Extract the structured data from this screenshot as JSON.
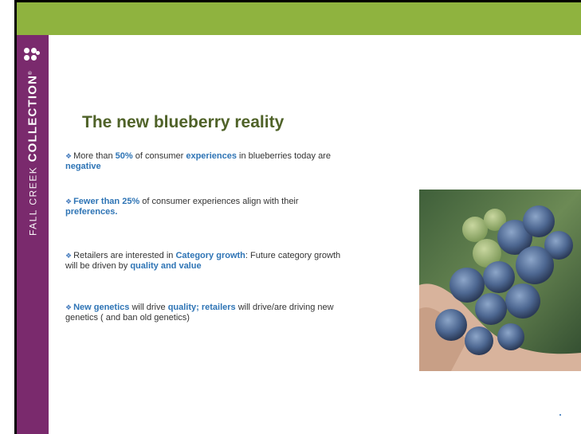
{
  "brand": {
    "light": "FALL CREEK",
    "bold": "COLLECTION",
    "mark": "®"
  },
  "title": "The new blueberry reality",
  "bullets": [
    {
      "parts": [
        {
          "t": "More than ",
          "hl": false
        },
        {
          "t": "50%",
          "hl": true
        },
        {
          "t": " of consumer ",
          "hl": false
        },
        {
          "t": "experiences",
          "hl": true
        },
        {
          "t": " in blueberries today are",
          "hl": false
        },
        {
          "t": "negative",
          "hl": true,
          "br": true
        }
      ]
    },
    {
      "parts": [
        {
          "t": "Fewer than 25%",
          "hl": true
        },
        {
          "t": " of consumer experiences align with their",
          "hl": false
        },
        {
          "t": "preferences.",
          "hl": true,
          "br": true
        }
      ]
    },
    {
      "parts": [
        {
          "t": "Retailers are interested in ",
          "hl": false
        },
        {
          "t": "Category growth",
          "hl": true
        },
        {
          "t": ": Future category growth",
          "hl": false
        },
        {
          "t": "will be driven by ",
          "hl": false,
          "br": true
        },
        {
          "t": "quality and value",
          "hl": true
        }
      ]
    },
    {
      "parts": [
        {
          "t": "New genetics",
          "hl": true
        },
        {
          "t": " will drive ",
          "hl": false
        },
        {
          "t": "quality; retailers",
          "hl": true
        },
        {
          "t": " will drive/are driving new",
          "hl": false
        },
        {
          "t": "genetics ( and ban old genetics)",
          "hl": false,
          "br": true
        }
      ]
    }
  ],
  "photo": {
    "alt_icon": "blueberries-in-hand-photo"
  },
  "colors": {
    "topbar": "#8fb33f",
    "sidebar": "#7a2a6d",
    "title": "#4f6228",
    "highlight": "#2e74b5"
  }
}
